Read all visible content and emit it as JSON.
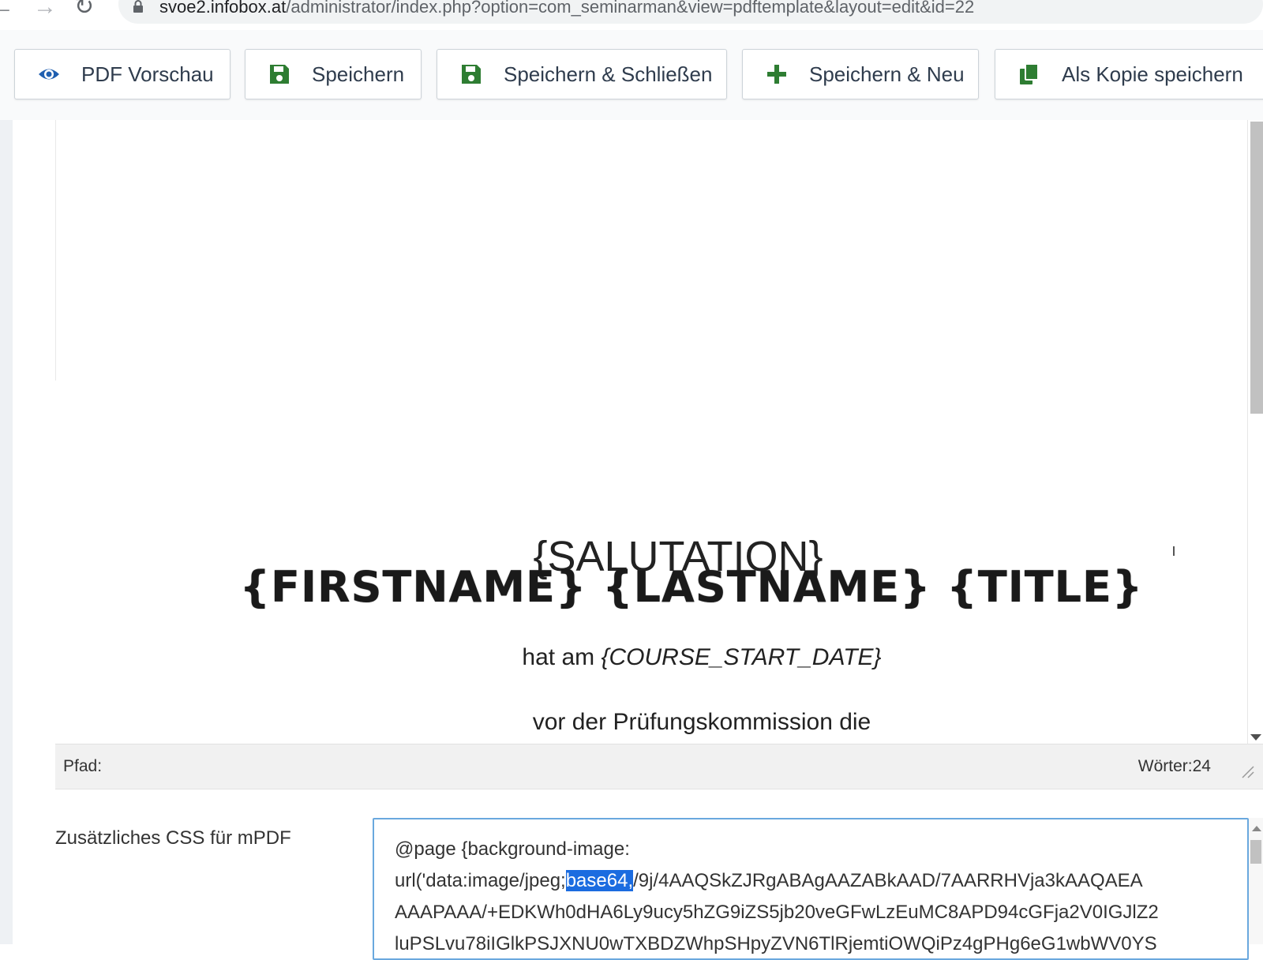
{
  "browser": {
    "url_host": "svoe2.infobox.at",
    "url_path": "/administrator/index.php?option=com_seminarman&view=pdftemplate&layout=edit&id=22"
  },
  "toolbar": {
    "preview_label": "PDF Vorschau",
    "save_label": "Speichern",
    "save_close_label": "Speichern & Schließen",
    "save_new_label": "Speichern & Neu",
    "save_copy_label": "Als Kopie speichern"
  },
  "editor": {
    "salutation": "{SALUTATION}",
    "names": "{FIRSTNAME} {LASTNAME} {TITLE}",
    "date_prefix": "hat am ",
    "date_placeholder": "{COURSE_START_DATE}",
    "exam_line": "vor der Prüfungskommission die"
  },
  "statusbar": {
    "path_label": "Pfad:",
    "words_label": "Wörter:24"
  },
  "css_field": {
    "label": "Zusätzliches CSS für mPDF",
    "line1": "@page {background-image:",
    "line2_prefix": "url('data:image/jpeg;",
    "line2_selected": "base64,",
    "line2_suffix": "/9j/4AAQSkZJRgABAgAAZABkAAD/7AARRHVja3kAAQAEA",
    "line3": "AAAPAAA/+EDKWh0dHA6Ly9ucy5hZG9iZS5jb20veGFwLzEuMC8APD94cGFja2V0IGJlZ2",
    "line4": "luPSLvu78iIGlkPSJXNU0wTXBDZWhpSHpyZVN6TlRjemtiOWQiPz4gPHg6eG1wbWV0YS"
  },
  "colors": {
    "accent_blue": "#1f5fb0",
    "save_green": "#2e7d32",
    "selection": "#1b6ce0"
  },
  "icons": {
    "back": "arrow-left-icon",
    "forward": "arrow-right-icon",
    "reload": "reload-icon",
    "lock": "lock-icon",
    "preview": "eye-icon",
    "save": "floppy-disk-icon",
    "new": "plus-icon",
    "copy": "copy-icon"
  }
}
